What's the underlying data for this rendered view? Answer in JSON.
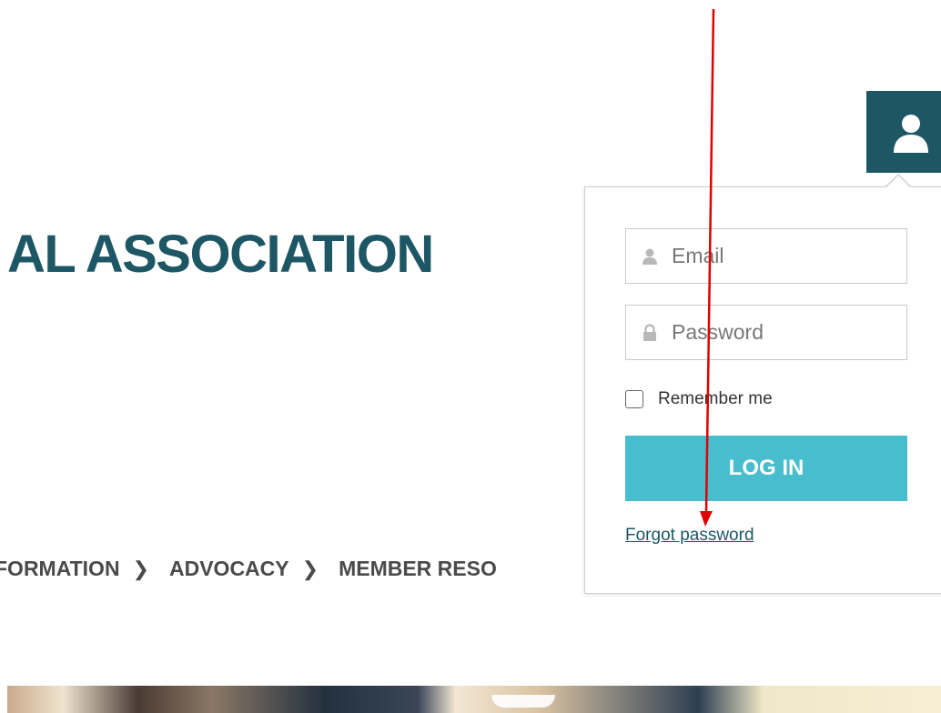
{
  "header": {
    "site_title": "AL ASSOCIATION"
  },
  "nav": {
    "items": [
      {
        "label": "FORMATION",
        "chevron": "❯"
      },
      {
        "label": "ADVOCACY",
        "chevron": "❯"
      },
      {
        "label": "MEMBER RESO",
        "chevron": ""
      }
    ]
  },
  "user_menu": {
    "icon": "user-icon",
    "background": "#1d5765"
  },
  "login": {
    "email_placeholder": "Email",
    "email_icon": "person-icon",
    "password_placeholder": "Password",
    "password_icon": "lock-icon",
    "remember_label": "Remember me",
    "login_button_label": "LOG IN",
    "login_button_color": "#47bdcd",
    "forgot_password_label": "Forgot password"
  },
  "annotation": {
    "arrow_color": "#e00000"
  }
}
